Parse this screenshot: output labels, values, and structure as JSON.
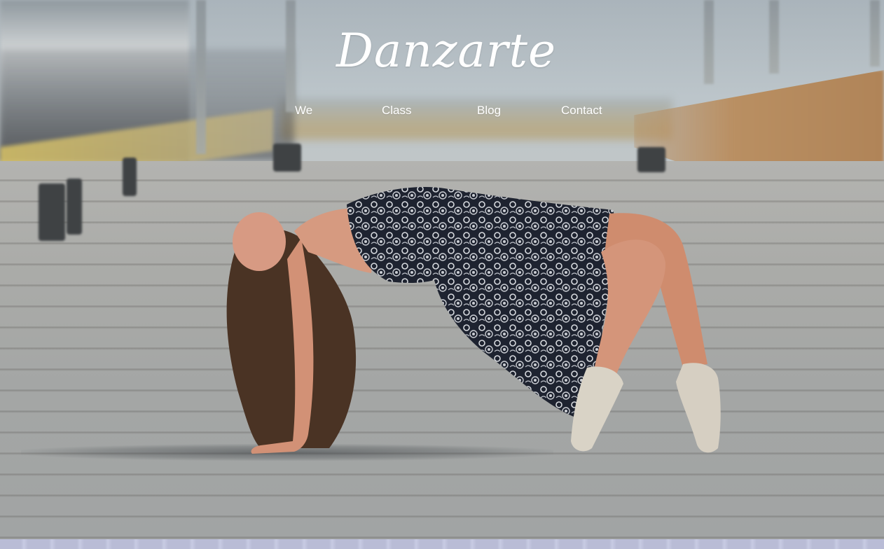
{
  "site": {
    "logo": "Danzarte"
  },
  "nav": {
    "items": [
      {
        "label": "We"
      },
      {
        "label": "Class"
      },
      {
        "label": "Blog"
      },
      {
        "label": "Contact"
      }
    ]
  },
  "hero": {
    "accent_color": "#ffffff",
    "dress_color": "#1e2330"
  }
}
